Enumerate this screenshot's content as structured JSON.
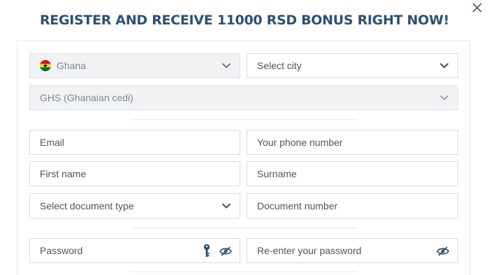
{
  "dialog": {
    "title": "REGISTER AND RECEIVE 11000 RSD BONUS RIGHT NOW!"
  },
  "location": {
    "country": "Ghana",
    "city_placeholder": "Select city",
    "currency": "GHS (Ghanaian cedi)"
  },
  "contact": {
    "email_placeholder": "Email",
    "phone_placeholder": "Your phone number"
  },
  "personal": {
    "first_name_placeholder": "First name",
    "surname_placeholder": "Surname",
    "document_type_placeholder": "Select document type",
    "document_number_placeholder": "Document number"
  },
  "security": {
    "password_placeholder": "Password",
    "reenter_password_placeholder": "Re-enter your password"
  },
  "colors": {
    "title": "#2e5074",
    "border": "#d4d9de",
    "disabled_bg": "#f1f2f3",
    "icon": "#2e5074"
  },
  "icons": [
    "close-icon",
    "ghana-flag-icon",
    "chevron-down-icon",
    "key-icon",
    "eye-slash-icon"
  ]
}
